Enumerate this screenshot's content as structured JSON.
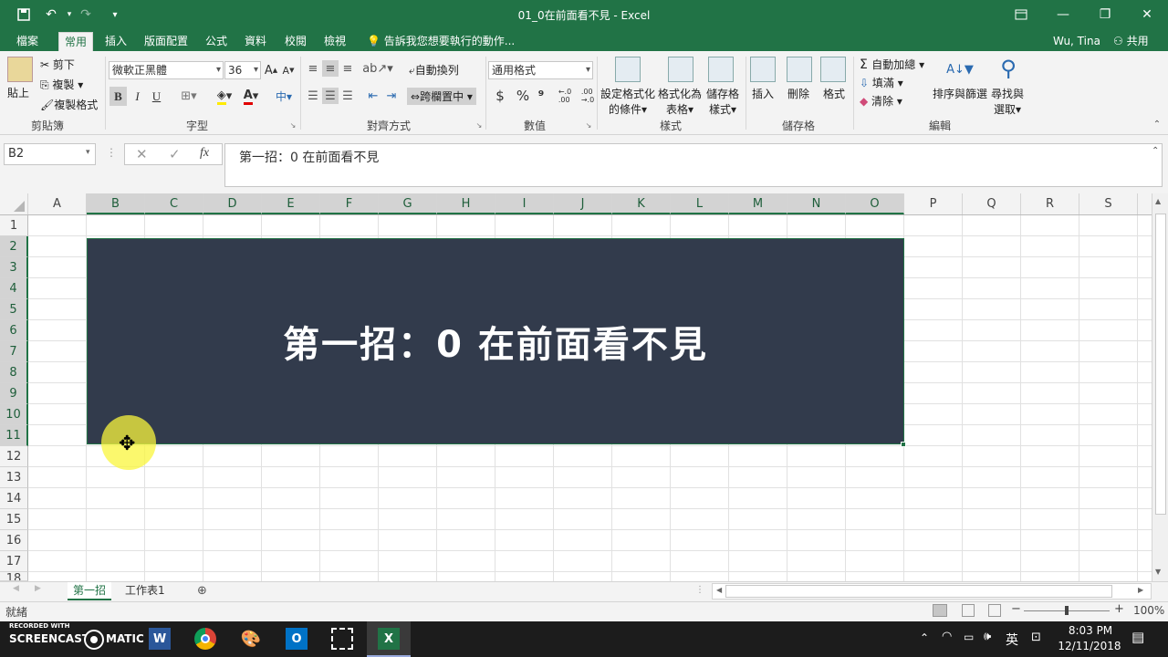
{
  "window": {
    "title": "01_0在前面看不見 - Excel",
    "user": "Wu, Tina",
    "share_label": "共用"
  },
  "ribbon_tabs": [
    "檔案",
    "常用",
    "插入",
    "版面配置",
    "公式",
    "資料",
    "校閱",
    "檢視"
  ],
  "tell_me": "告訴我您想要執行的動作...",
  "clipboard": {
    "paste": "貼上",
    "cut": "剪下",
    "copy": "複製",
    "format_painter": "複製格式",
    "label": "剪貼簿"
  },
  "font": {
    "name": "微軟正黑體",
    "size": "36",
    "label": "字型",
    "bold": "B",
    "italic": "I",
    "underline": "U"
  },
  "alignment": {
    "wrap": "自動換列",
    "merge": "跨欄置中",
    "label": "對齊方式"
  },
  "number": {
    "format": "通用格式",
    "currency": "$",
    "percent": "%",
    "comma": "⁹",
    "label": "數值"
  },
  "styles": {
    "cond_format_1": "設定格式化",
    "cond_format_2": "的條件",
    "table_1": "格式化為",
    "table_2": "表格",
    "cell_1": "儲存格",
    "cell_2": "樣式",
    "label": "樣式"
  },
  "cells_group": {
    "insert": "插入",
    "delete": "刪除",
    "format": "格式",
    "label": "儲存格"
  },
  "editing": {
    "autosum": "自動加總",
    "fill": "填滿",
    "clear": "清除",
    "sort_1": "排序與篩選",
    "find_1": "尋找與",
    "find_2": "選取",
    "label": "編輯"
  },
  "formula_bar": {
    "name_box": "B2",
    "fx": "fx",
    "content": "第一招：0 在前面看不見"
  },
  "columns": [
    "A",
    "B",
    "C",
    "D",
    "E",
    "F",
    "G",
    "H",
    "I",
    "J",
    "K",
    "L",
    "M",
    "N",
    "O",
    "P",
    "Q",
    "R",
    "S"
  ],
  "rows": [
    "1",
    "2",
    "3",
    "4",
    "5",
    "6",
    "7",
    "8",
    "9",
    "10",
    "11",
    "12",
    "14",
    "15",
    "17",
    "18"
  ],
  "rows_full": [
    "1",
    "2",
    "3",
    "4",
    "5",
    "6",
    "7",
    "8",
    "9",
    "10",
    "11",
    "12",
    "14",
    "15",
    "16",
    "17",
    "18"
  ],
  "cell_B2": "第一招：0 在前面看不見",
  "sheets": [
    "第一招",
    "工作表1"
  ],
  "status": {
    "ready": "就緒",
    "zoom": "100%"
  },
  "taskbar": {
    "recorded_1": "RECORDED WITH",
    "recorded_2": "SCREENCAST",
    "matic": "MATIC",
    "ime": "英",
    "time": "8:03 PM",
    "date": "12/11/2018"
  },
  "colors": {
    "accent": "#217346",
    "merged_bg": "#323b4c"
  }
}
